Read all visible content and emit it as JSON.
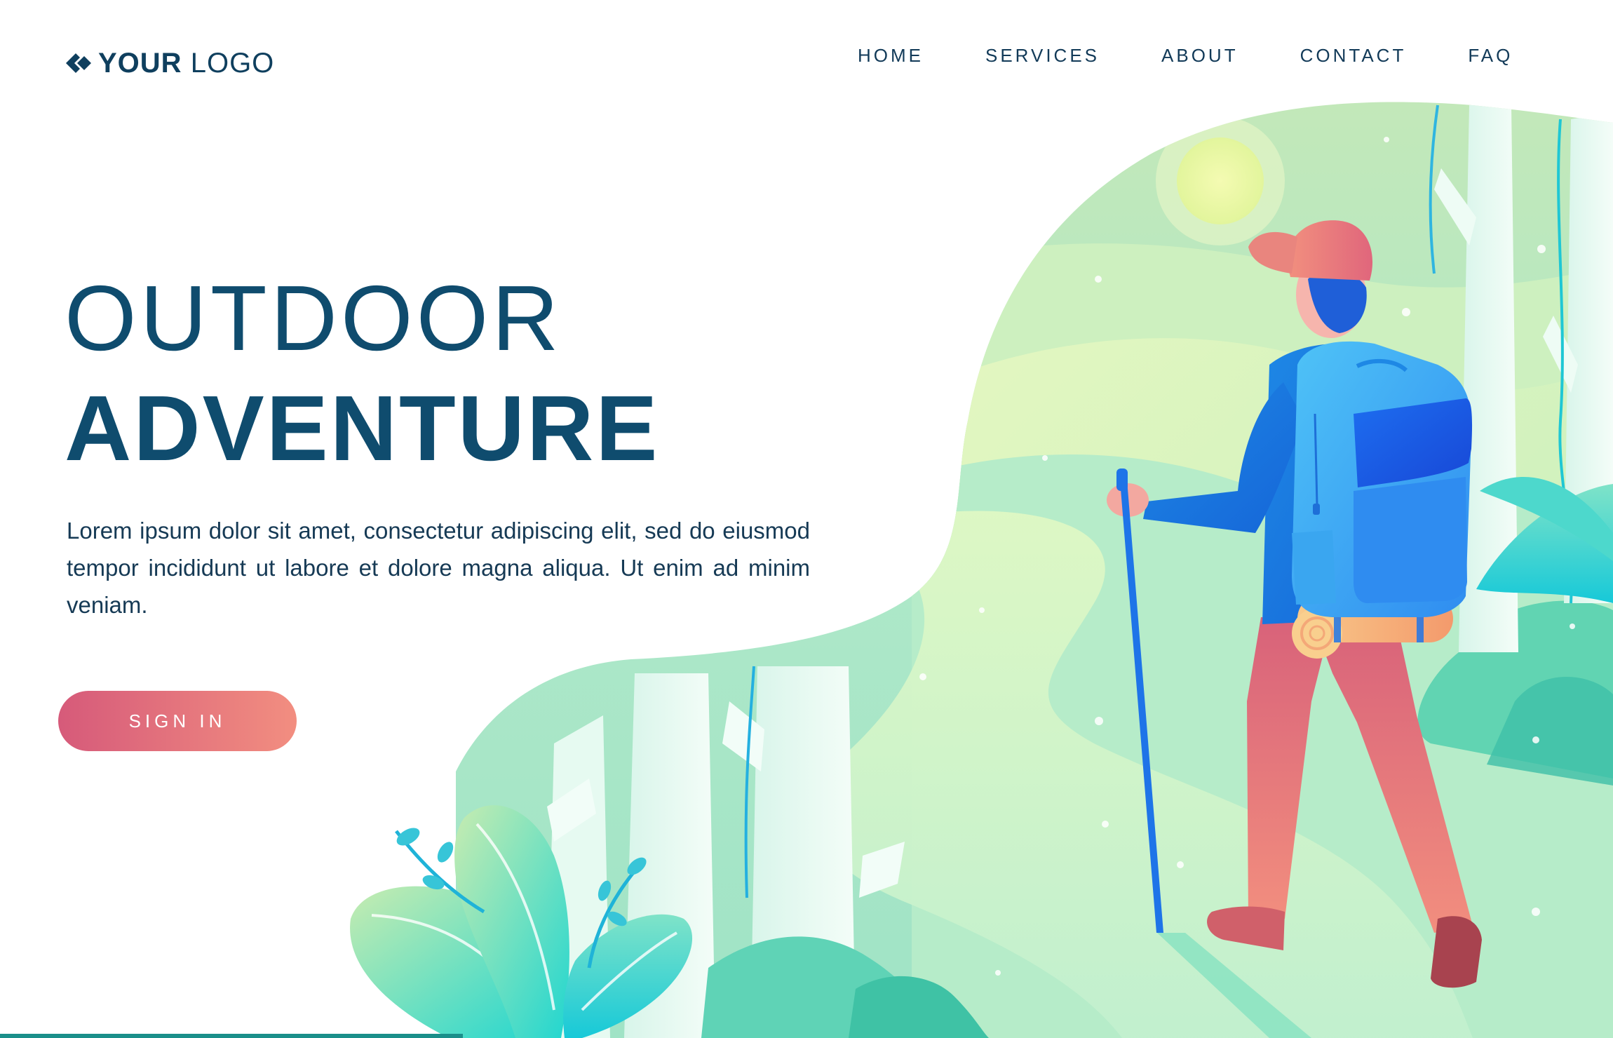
{
  "header": {
    "logo_strong": "YOUR",
    "logo_light": "LOGO",
    "logo_icon": "diamond-logo-icon",
    "nav": [
      "HOME",
      "SERVICES",
      "ABOUT",
      "CONTACT",
      "FAQ"
    ]
  },
  "hero": {
    "title_line1": "OUTDOOR",
    "title_line2": "ADVENTURE",
    "body": "Lorem ipsum dolor sit amet, consectetur adipiscing elit, sed do eiusmod tempor incididunt ut labore et dolore magna aliqua. Ut enim ad minim veniam.",
    "cta_label": "SIGN IN"
  },
  "colors": {
    "heading": "#0f4c6e",
    "cta_start": "#d65a7a",
    "cta_end": "#f28e80",
    "landscape": "#a8e6c4",
    "backpack": "#3aa0f0"
  }
}
